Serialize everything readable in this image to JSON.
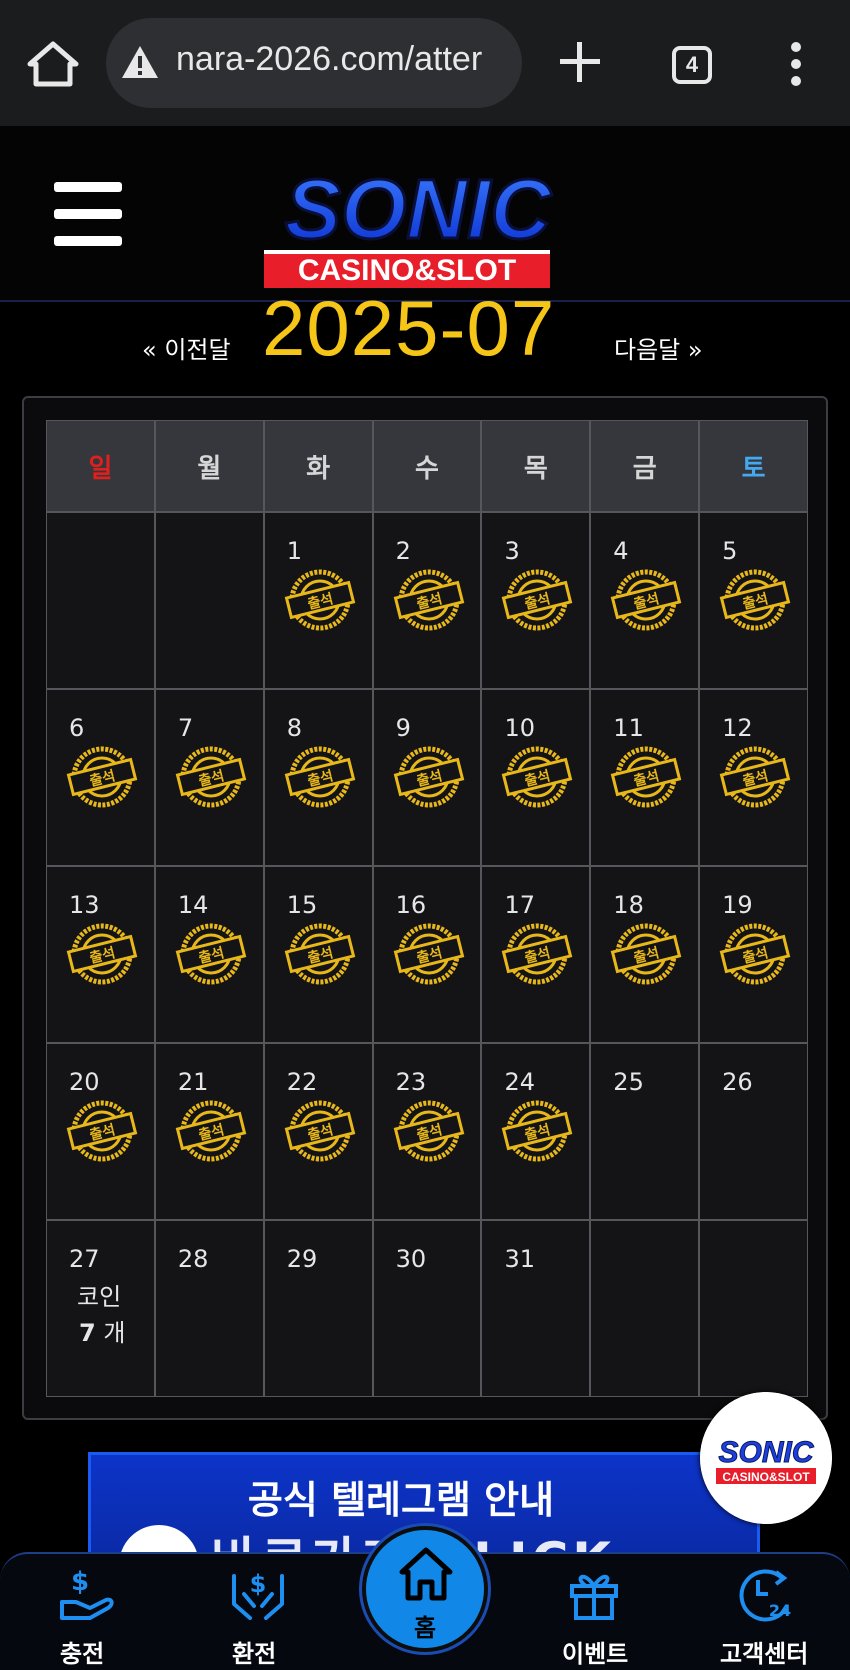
{
  "browser": {
    "url": "nara-2026.com/atter",
    "tab_count": "4",
    "icons": [
      "home-icon",
      "warning-icon",
      "plus-icon",
      "tabs-icon",
      "more-vert-icon"
    ]
  },
  "header": {
    "logo_text": "SONIC",
    "logo_sub": "CASINO&SLOT"
  },
  "month_nav": {
    "prev": "« 이전달",
    "title": "2025-07",
    "next": "다음달 »"
  },
  "calendar": {
    "weekdays": [
      "일",
      "월",
      "화",
      "수",
      "목",
      "금",
      "토"
    ],
    "stamp_text": "출석",
    "weeks": [
      [
        {
          "day": "",
          "stamp": false
        },
        {
          "day": "",
          "stamp": false
        },
        {
          "day": "1",
          "stamp": true
        },
        {
          "day": "2",
          "stamp": true
        },
        {
          "day": "3",
          "stamp": true
        },
        {
          "day": "4",
          "stamp": true
        },
        {
          "day": "5",
          "stamp": true
        }
      ],
      [
        {
          "day": "6",
          "stamp": true
        },
        {
          "day": "7",
          "stamp": true
        },
        {
          "day": "8",
          "stamp": true
        },
        {
          "day": "9",
          "stamp": true
        },
        {
          "day": "10",
          "stamp": true
        },
        {
          "day": "11",
          "stamp": true
        },
        {
          "day": "12",
          "stamp": true
        }
      ],
      [
        {
          "day": "13",
          "stamp": true
        },
        {
          "day": "14",
          "stamp": true
        },
        {
          "day": "15",
          "stamp": true
        },
        {
          "day": "16",
          "stamp": true
        },
        {
          "day": "17",
          "stamp": true
        },
        {
          "day": "18",
          "stamp": true
        },
        {
          "day": "19",
          "stamp": true
        }
      ],
      [
        {
          "day": "20",
          "stamp": true
        },
        {
          "day": "21",
          "stamp": true
        },
        {
          "day": "22",
          "stamp": true
        },
        {
          "day": "23",
          "stamp": true
        },
        {
          "day": "24",
          "stamp": true
        },
        {
          "day": "25",
          "stamp": false
        },
        {
          "day": "26",
          "stamp": false
        }
      ],
      [
        {
          "day": "27",
          "stamp": false
        },
        {
          "day": "28",
          "stamp": false
        },
        {
          "day": "29",
          "stamp": false
        },
        {
          "day": "30",
          "stamp": false
        },
        {
          "day": "31",
          "stamp": false
        },
        {
          "day": "",
          "stamp": false
        },
        {
          "day": "",
          "stamp": false
        }
      ]
    ],
    "coin_label": "코인",
    "coin_count": "7",
    "coin_unit": " 개"
  },
  "banner": {
    "title": "공식 텔레그램 안내",
    "sub": "바로가기 CLICK"
  },
  "bottom_nav": {
    "items": [
      "충전",
      "환전",
      "홈",
      "이벤트",
      "고객센터"
    ]
  },
  "colors": {
    "accent_gold": "#f5c518",
    "sunday": "#e0201d",
    "saturday": "#45a9f0",
    "nav_blue": "#1188e8"
  }
}
